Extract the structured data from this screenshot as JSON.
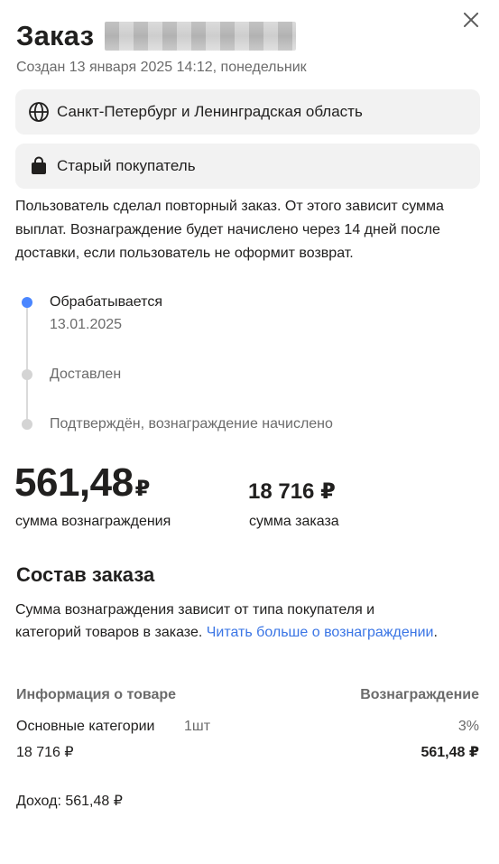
{
  "header": {
    "title": "Заказ",
    "created": "Создан 13 января 2025 14:12, понедельник"
  },
  "chips": {
    "region": "Санкт-Петербург и Ленинградская область",
    "buyer_type": "Старый покупатель"
  },
  "description": "Пользователь сделал повторный заказ. От этого зависит сумма выплат. Вознаграждение будет начислено через 14 дней после доставки, если пользователь не оформит возврат.",
  "timeline": {
    "steps": [
      {
        "label": "Обрабатывается",
        "date": "13.01.2025",
        "active": true
      },
      {
        "label": "Доставлен",
        "active": false
      },
      {
        "label": "Подтверждён, вознаграждение начислено",
        "active": false
      }
    ]
  },
  "summary": {
    "reward_value": "561,48",
    "currency": "₽",
    "reward_caption": "сумма вознаграждения",
    "order_sum": "18 716 ₽",
    "order_caption": "сумма заказа"
  },
  "composition": {
    "title": "Состав заказа",
    "text": "Сумма вознаграждения зависит от типа покупателя и категорий товаров в заказе. ",
    "link": "Читать больше о вознаграждении",
    "link_suffix": ".",
    "header_product": "Информация о товаре",
    "header_reward": "Вознаграждение",
    "row": {
      "category": "Основные категории",
      "qty": "1шт",
      "percent": "3%",
      "sum": "18 716 ₽",
      "reward": "561,48 ₽"
    },
    "income": "Доход: 561,48 ₽"
  },
  "icons": {
    "close": "close-icon",
    "region": "globe-icon",
    "buyer": "shopping-bag-icon"
  },
  "colors": {
    "accent": "#4a86ff",
    "link": "#3a75e5",
    "chip_bg": "#f2f2f2"
  }
}
